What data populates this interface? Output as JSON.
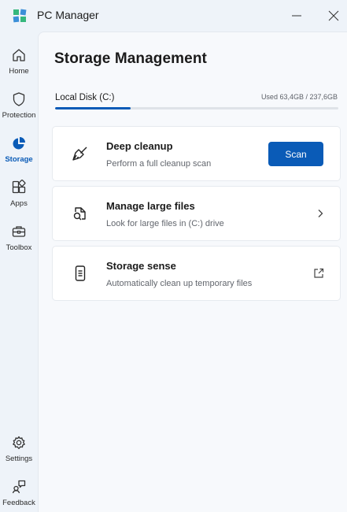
{
  "window": {
    "title": "PC Manager",
    "logo_colors": [
      "#2bb57a",
      "#3a8fd6"
    ],
    "minimize_icon": "minimize-icon",
    "close_icon": "close-icon"
  },
  "sidebar": {
    "items": [
      {
        "label": "Home",
        "icon": "home-icon",
        "active": false
      },
      {
        "label": "Protection",
        "icon": "shield-icon",
        "active": false
      },
      {
        "label": "Storage",
        "icon": "pie-chart-icon",
        "active": true
      },
      {
        "label": "Apps",
        "icon": "apps-grid-icon",
        "active": false
      },
      {
        "label": "Toolbox",
        "icon": "toolbox-icon",
        "active": false
      }
    ],
    "bottom_items": [
      {
        "label": "Settings",
        "icon": "gear-icon"
      },
      {
        "label": "Feedback",
        "icon": "feedback-icon"
      }
    ]
  },
  "main": {
    "title": "Storage Management",
    "disk": {
      "label": "Local Disk (C:)",
      "usage_text": "Used 63,4GB / 237,6GB",
      "used_fraction": 0.267
    },
    "cards": [
      {
        "title": "Deep cleanup",
        "description": "Perform a full cleanup scan",
        "icon": "broom-icon",
        "action_label": "Scan"
      },
      {
        "title": "Manage large files",
        "description": "Look for large files in (C:) drive",
        "icon": "file-search-icon",
        "action_icon": "chevron-right-icon"
      },
      {
        "title": "Storage sense",
        "description": "Automatically clean up temporary files",
        "icon": "phone-storage-icon",
        "action_icon": "open-external-icon"
      }
    ]
  },
  "colors": {
    "accent": "#0a5bb7",
    "background": "#eef3f9",
    "card": "#ffffff"
  }
}
